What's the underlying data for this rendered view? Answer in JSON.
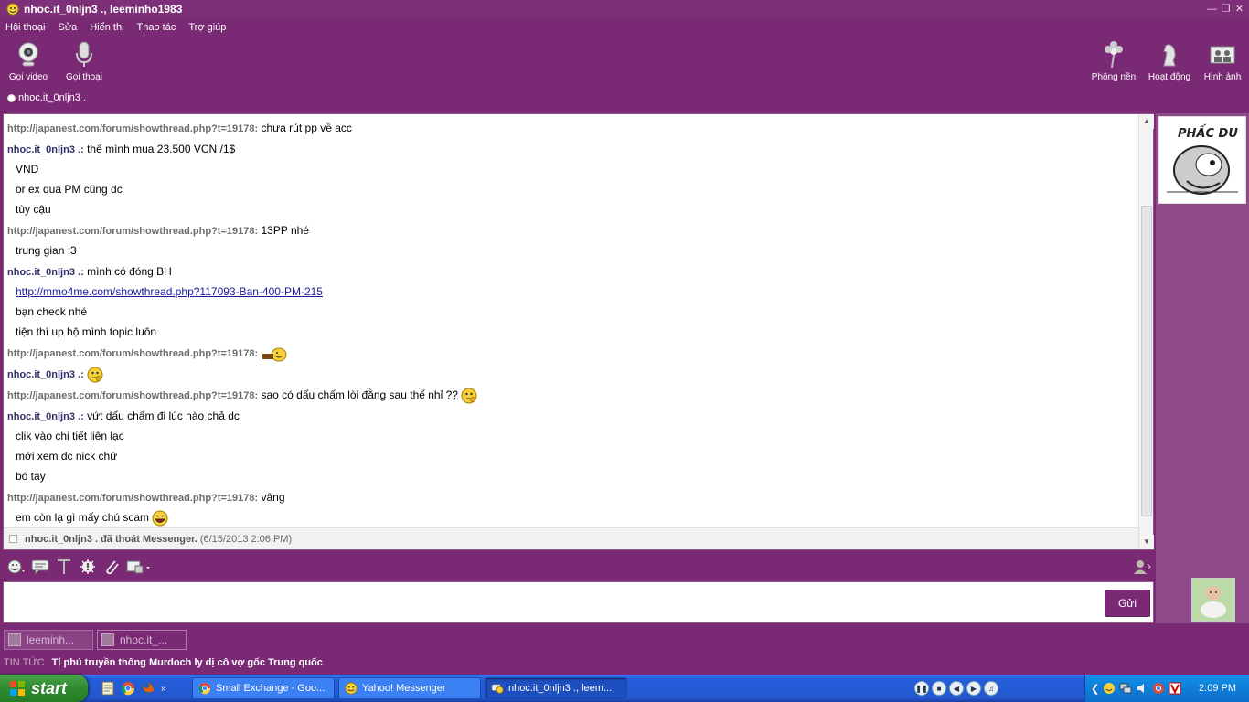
{
  "window": {
    "title": "nhoc.it_0nljn3 ., leeminho1983",
    "controls": [
      "minimize",
      "restore",
      "close"
    ]
  },
  "menu": [
    "Hội thoại",
    "Sửa",
    "Hiển thị",
    "Thao tác",
    "Trợ giúp"
  ],
  "toolbar": {
    "video_call": "Gọi video",
    "voice_call": "Gọi thoại",
    "backgrounds": "Phông nền",
    "activities": "Hoạt động",
    "photos": "Hình ảnh"
  },
  "contact": {
    "name": "nhoc.it_0nljn3 ."
  },
  "messages": [
    {
      "sender": "http://japanest.com/forum/showthread.php?t=19178:",
      "who": "them",
      "text": "chưa rút pp về acc"
    },
    {
      "sender": "nhoc.it_0nljn3 .:",
      "who": "me",
      "text": "thế mình mua 23.500 VCN /1$"
    },
    {
      "cont": "VND"
    },
    {
      "cont": "or ex qua PM cũng dc"
    },
    {
      "cont": "tùy cậu"
    },
    {
      "sender": "http://japanest.com/forum/showthread.php?t=19178:",
      "who": "them",
      "text": "13PP nhé"
    },
    {
      "cont": "trung gian :3"
    },
    {
      "sender": "nhoc.it_0nljn3 .:",
      "who": "me",
      "text": "mình có đóng BH"
    },
    {
      "cont": "http://mmo4me.com/showthread.php?117093-Ban-400-PM-215",
      "link": true
    },
    {
      "cont": "bạn check nhé"
    },
    {
      "cont": "tiện thì up hộ mình topic luôn"
    },
    {
      "sender": "http://japanest.com/forum/showthread.php?t=19178:",
      "who": "them",
      "text": "",
      "emoticon": "lying-down-emoticon"
    },
    {
      "sender": "nhoc.it_0nljn3 .:",
      "who": "me",
      "text": "",
      "emoticon": "thinking-emoticon"
    },
    {
      "sender": "http://japanest.com/forum/showthread.php?t=19178:",
      "who": "them",
      "text": "sao có dấu chấm lòi đằng sau thế nhỉ ??",
      "emoticon": "thinking-emoticon"
    },
    {
      "sender": "nhoc.it_0nljn3 .:",
      "who": "me",
      "text": "vứt dấu chấm đi lúc nào chả dc"
    },
    {
      "cont": "clik vào chi tiết liên lạc"
    },
    {
      "cont": "mới xem dc nick chứ"
    },
    {
      "cont": "bó tay"
    },
    {
      "sender": "http://japanest.com/forum/showthread.php?t=19178:",
      "who": "them",
      "text": "vâng"
    },
    {
      "cont": "em còn lạ gì mấy chú scam",
      "emoticon": "laughing-emoticon"
    }
  ],
  "status_line": {
    "name": "nhoc.it_0nljn3 .",
    "text": "đã thoát Messenger.",
    "time": "(6/15/2013 2:06 PM)"
  },
  "avatar_text": "PHẤC DU",
  "input": {
    "value": "",
    "send_label": "Gửi"
  },
  "conversation_tabs": [
    {
      "label": "leeminh...",
      "active": false
    },
    {
      "label": "nhoc.it_...",
      "active": true
    }
  ],
  "news": {
    "label": "TIN TỨC",
    "headline": "Tỉ phú truyền thông Murdoch ly dị cô vợ gốc Trung quốc"
  },
  "taskbar": {
    "start_label": "start",
    "tasks": [
      {
        "label": "Small Exchange - Goo...",
        "icon": "chrome-icon",
        "active": false
      },
      {
        "label": "Yahoo! Messenger",
        "icon": "yahoo-smiley-icon",
        "active": false
      },
      {
        "label": "nhoc.it_0nljn3 ., leem...",
        "icon": "messenger-chat-icon",
        "active": true
      }
    ],
    "clock": "2:09 PM"
  },
  "colors": {
    "frame": "#7a2a74",
    "title_bar": "#7d2f77",
    "them_sender": "#6d6d6d",
    "me_sender": "#2e2f6a",
    "link": "#1a1a9a"
  }
}
